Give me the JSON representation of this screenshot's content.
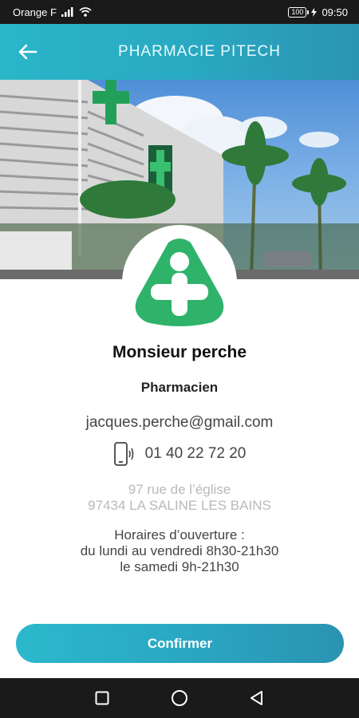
{
  "status_bar": {
    "carrier": "Orange F",
    "battery": "100",
    "time": "09:50"
  },
  "header": {
    "title": "PHARMACIE PITECH",
    "back_icon": "arrow-left-icon"
  },
  "hero": {
    "image": "pharmacy-building-photo"
  },
  "profile": {
    "name": "Monsieur perche",
    "role": "Pharmacien",
    "email": "jacques.perche@gmail.com",
    "phone_icon": "phone-call-icon",
    "phone": "01 40 22 72 20",
    "address_line1": "97 rue de l’église",
    "address_line2": "97434 LA SALINE LES BAINS",
    "hours_title": "Horaires d’ouverture :",
    "hours_line1": "du lundi au vendredi 8h30-21h30",
    "hours_line2": "le samedi 9h-21h30"
  },
  "actions": {
    "confirm_label": "Confirmer"
  },
  "colors": {
    "accent": "#2aa6c2",
    "logo_green": "#2fb36a"
  }
}
